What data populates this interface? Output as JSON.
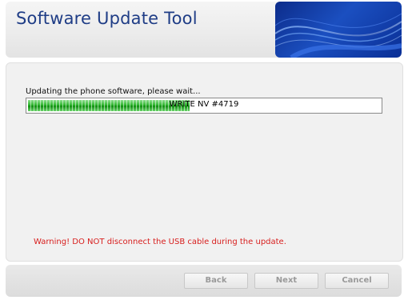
{
  "window": {
    "title": "Software Update Tool"
  },
  "content": {
    "status_label": "Updating the phone software, please wait...",
    "progress": {
      "text": "WRITE NV #4719",
      "fraction": 0.46,
      "bar_color": "#2fb52f"
    },
    "warning": "Warning! DO NOT disconnect the USB cable during the update.",
    "warning_color": "#d8201f"
  },
  "footer": {
    "back_label": "Back",
    "next_label": "Next",
    "cancel_label": "Cancel",
    "buttons_enabled": false
  },
  "colors": {
    "title": "#1f3d86",
    "banner": "#1b4fc0"
  }
}
